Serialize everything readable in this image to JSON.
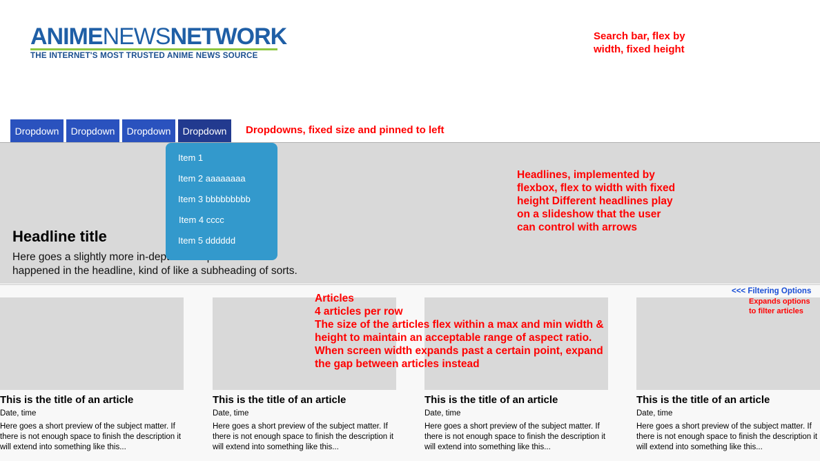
{
  "logo": {
    "strong": "ANIME",
    "light": "NEWS",
    "strong2": "NETWORK",
    "tagline": "THE INTERNET'S MOST TRUSTED ANIME NEWS SOURCE"
  },
  "notes": {
    "search": "Search bar, flex by width, fixed height",
    "dropdowns": "Dropdowns, fixed size and pinned to left",
    "headlines": "Headlines, implemented by flexbox, flex to width with fixed height Different headlines play on a slideshow that the user can control with arrows",
    "articles_heading": "Articles",
    "articles_per_row": "4 articles per row",
    "articles_body": "The size of the articles flex within a max and min width & height to maintain an acceptable range of aspect ratio. When screen width expands past a certain point, expand the gap between articles instead",
    "filter_note": "Expands options to filter articles"
  },
  "nav": {
    "buttons": [
      "Dropdown",
      "Dropdown",
      "Dropdown",
      "Dropdown"
    ]
  },
  "menu": {
    "items": [
      "Item 1",
      "Item 2 aaaaaaaa",
      "Item 3 bbbbbbbbb",
      "Item 4 cccc",
      "Item 5 dddddd"
    ]
  },
  "headline": {
    "title": "Headline title",
    "subtitle": "Here goes a slightly more in-depth description of what happened in the headline, kind of like a subheading of sorts."
  },
  "filter": {
    "label": "<<< Filtering Options"
  },
  "articles": [
    {
      "title": "This is the title of an article",
      "date": "Date, time",
      "desc": "Here goes a short preview of the subject matter. If there is not enough space to finish the description it will extend into something like this..."
    },
    {
      "title": "This is the title of an article",
      "date": "Date, time",
      "desc": "Here goes a short preview of the subject matter. If there is not enough space to finish the description it will extend into something like this..."
    },
    {
      "title": "This is the title of an article",
      "date": "Date, time",
      "desc": "Here goes a short preview of the subject matter. If there is not enough space to finish the description it will extend into something like this..."
    },
    {
      "title": "This is the title of an article",
      "date": "Date, time",
      "desc": "Here goes a short preview of the subject matter. If there is not enough space to finish the description it will extend into something like this..."
    }
  ],
  "colors": {
    "nav_button": "#2a52be",
    "nav_button_active": "#223a8f",
    "menu_bg": "#3399cc",
    "note_red": "#ff0000",
    "filter_blue": "#1a4fd6",
    "logo_blue": "#1f5fa6",
    "logo_green": "#8dc63f"
  }
}
